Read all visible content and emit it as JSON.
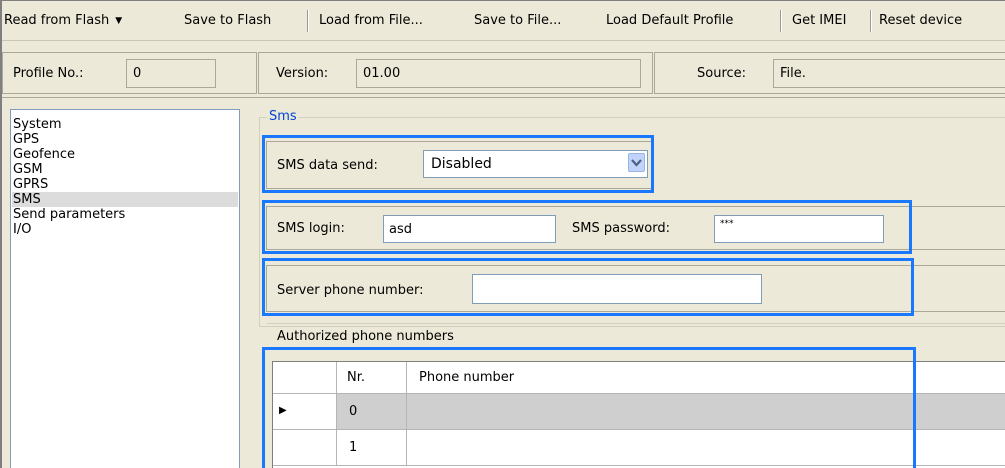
{
  "toolbar": {
    "read_flash": "Read from Flash",
    "save_flash": "Save to Flash",
    "load_file": "Load from File...",
    "save_file": "Save to File...",
    "load_default": "Load Default Profile",
    "get_imei": "Get IMEI",
    "reset_device": "Reset device"
  },
  "profile_bar": {
    "profile_label": "Profile No.:",
    "profile_value": "0",
    "version_label": "Version:",
    "version_value": "01.00",
    "source_label": "Source:",
    "source_value": "File."
  },
  "tree": {
    "items": [
      "System",
      "GPS",
      "Geofence",
      "GSM",
      "GPRS",
      "SMS",
      "Send parameters",
      "I/O"
    ],
    "selected": "SMS"
  },
  "sms": {
    "group_title": "Sms",
    "data_send_label": "SMS data send:",
    "data_send_value": "Disabled",
    "login_label": "SMS login:",
    "login_value": "asd",
    "password_label": "SMS password:",
    "password_value": "***",
    "server_phone_label": "Server phone number:",
    "server_phone_value": ""
  },
  "phones": {
    "caption": "Authorized phone numbers",
    "columns": [
      "Nr.",
      "Phone number"
    ],
    "rows": [
      {
        "nr": "0",
        "phone": ""
      },
      {
        "nr": "1",
        "phone": ""
      }
    ]
  },
  "colors": {
    "accent_highlight": "#1a78ff",
    "group_title": "#0046d5",
    "window_bg": "#ece9d8"
  }
}
